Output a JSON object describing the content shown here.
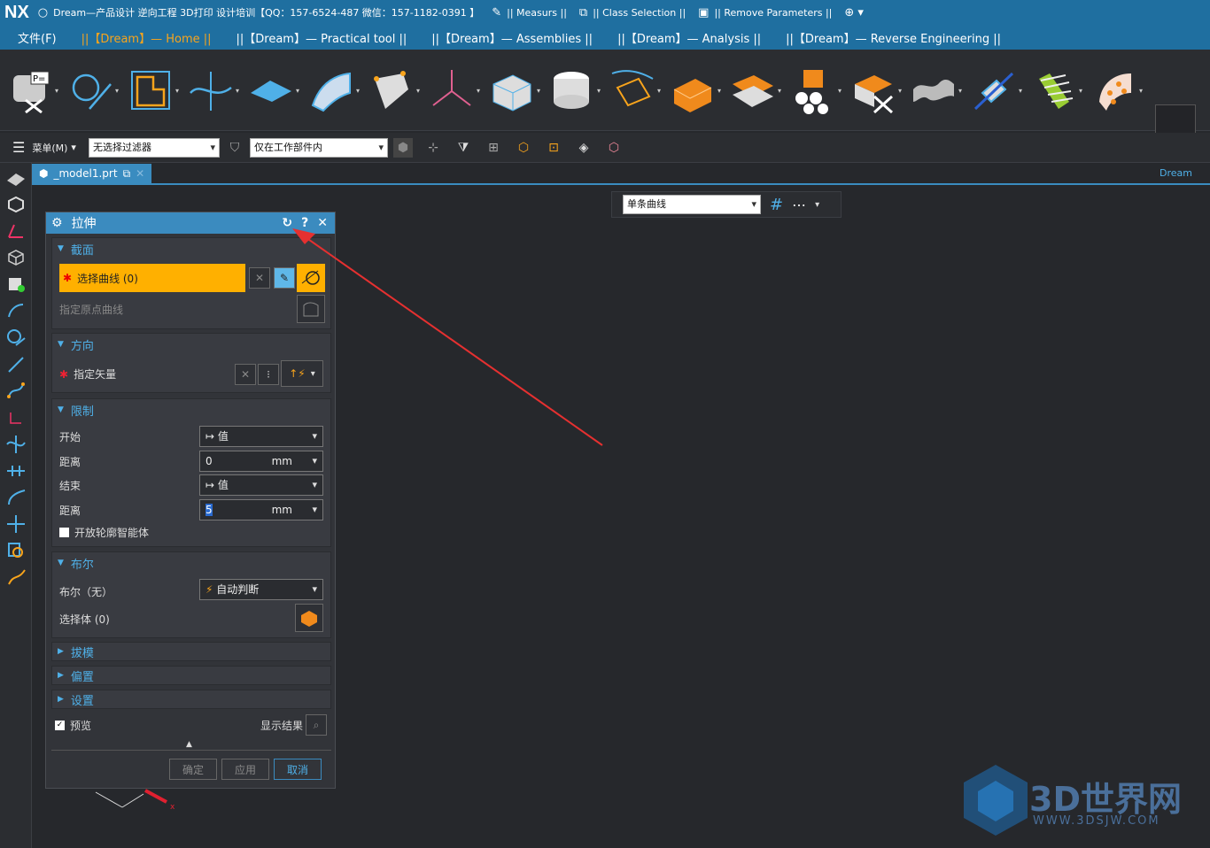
{
  "titlebar": {
    "logo": "NX",
    "title": "Dream—产品设计 逆向工程 3D打印 设计培训【QQ：157-6524-487 微信：157-1182-0391 】",
    "measure": "|| Measurs ||",
    "class_selection": "|| Class Selection ||",
    "remove_params": "|| Remove Parameters ||"
  },
  "menubar": {
    "file": "文件(F)",
    "tabs": [
      "||【Dream】— Home ||",
      "||【Dream】— Practical tool ||",
      "||【Dream】— Assemblies ||",
      "||【Dream】— Analysis ||",
      "||【Dream】— Reverse Engineering ||"
    ]
  },
  "ribbon": {
    "group_label": "Dream"
  },
  "selection_bar": {
    "menu": "菜单(M)",
    "filter": "无选择过滤器",
    "scope": "仅在工作部件内"
  },
  "file_tab": {
    "name": "_model1.prt"
  },
  "float_toolbar": {
    "curve_rule": "单条曲线"
  },
  "dialog": {
    "title": "拉伸",
    "section_section": {
      "header": "截面",
      "select_curve": "选择曲线 (0)",
      "origin_curve": "指定原点曲线"
    },
    "direction": {
      "header": "方向",
      "vector": "指定矢量"
    },
    "limits": {
      "header": "限制",
      "start_label": "开始",
      "start_value": "值",
      "dist1_label": "距离",
      "dist1_value": "0",
      "unit": "mm",
      "end_label": "结束",
      "end_value": "值",
      "dist2_label": "距离",
      "dist2_value": "5",
      "open_profile": "开放轮廓智能体"
    },
    "boolean": {
      "header": "布尔",
      "bool_label": "布尔（无）",
      "bool_value": "自动判断",
      "select_body": "选择体 (0)"
    },
    "draft": "拔模",
    "offset": "偏置",
    "settings": "设置",
    "preview": "预览",
    "show_result": "显示结果",
    "ok": "确定",
    "apply": "应用",
    "cancel": "取消"
  },
  "watermark": {
    "brand": "3D世界网",
    "url": "WWW.3DSJW.COM"
  },
  "colors": {
    "accent": "#1f6fa0",
    "active_tab": "#f8a41c",
    "highlight": "#ffb000",
    "section_header": "#4fb0e8"
  }
}
